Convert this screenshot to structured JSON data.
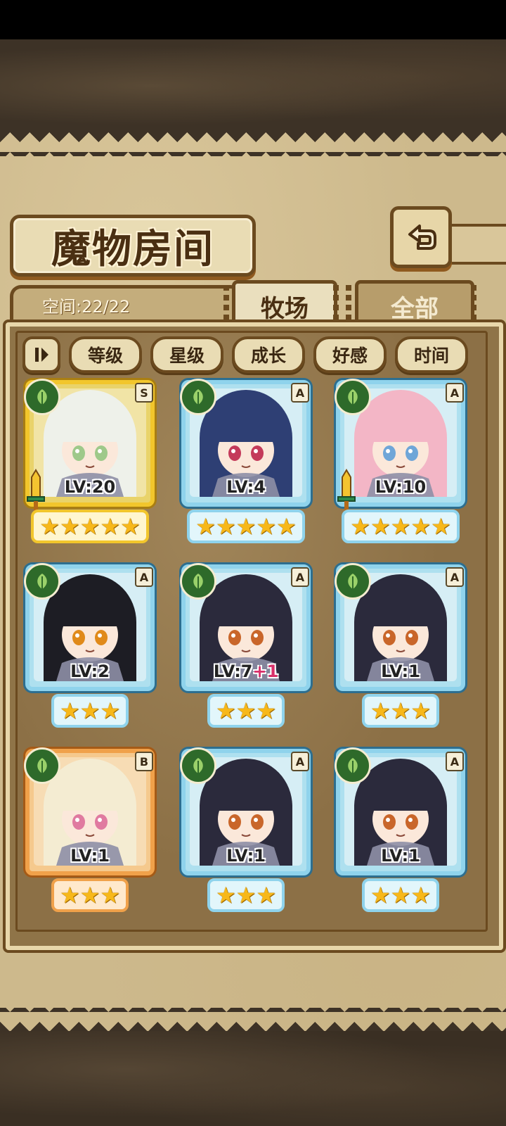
{
  "header": {
    "title": "魔物房间"
  },
  "info": {
    "space": "空间:22/22"
  },
  "tabs": [
    {
      "label": "牧场",
      "active": true
    },
    {
      "label": "全部",
      "active": false
    }
  ],
  "sort": {
    "toggle_icon": "sort-order-icon",
    "buttons": [
      "等级",
      "星级",
      "成长",
      "好感",
      "时间"
    ]
  },
  "monsters": [
    {
      "grade": "S",
      "level": "LV:20",
      "bonus": "",
      "stars": 5,
      "rarity": "gold",
      "weapon": true,
      "hair": "#eef1ea",
      "accent": "#9ec98a"
    },
    {
      "grade": "A",
      "level": "LV:4",
      "bonus": "",
      "stars": 5,
      "rarity": "blue",
      "weapon": false,
      "hair": "#2e3f74",
      "accent": "#c43a5a"
    },
    {
      "grade": "A",
      "level": "LV:10",
      "bonus": "",
      "stars": 5,
      "rarity": "blue",
      "weapon": true,
      "hair": "#f3b6c6",
      "accent": "#6fa6d8"
    },
    {
      "grade": "A",
      "level": "LV:2",
      "bonus": "",
      "stars": 3,
      "rarity": "blue",
      "weapon": false,
      "hair": "#1d1d24",
      "accent": "#e08a1a"
    },
    {
      "grade": "A",
      "level": "LV:7",
      "bonus": "+1",
      "stars": 3,
      "rarity": "blue",
      "weapon": false,
      "hair": "#2b2a3c",
      "accent": "#c9662a"
    },
    {
      "grade": "A",
      "level": "LV:1",
      "bonus": "",
      "stars": 3,
      "rarity": "blue",
      "weapon": false,
      "hair": "#2b2a3c",
      "accent": "#c9662a"
    },
    {
      "grade": "B",
      "level": "LV:1",
      "bonus": "",
      "stars": 3,
      "rarity": "orange",
      "weapon": false,
      "hair": "#f4ecd2",
      "accent": "#e07aa0"
    },
    {
      "grade": "A",
      "level": "LV:1",
      "bonus": "",
      "stars": 3,
      "rarity": "blue",
      "weapon": false,
      "hair": "#2b2a3c",
      "accent": "#c9662a"
    },
    {
      "grade": "A",
      "level": "LV:1",
      "bonus": "",
      "stars": 3,
      "rarity": "blue",
      "weapon": false,
      "hair": "#2b2a3c",
      "accent": "#c9662a"
    }
  ]
}
